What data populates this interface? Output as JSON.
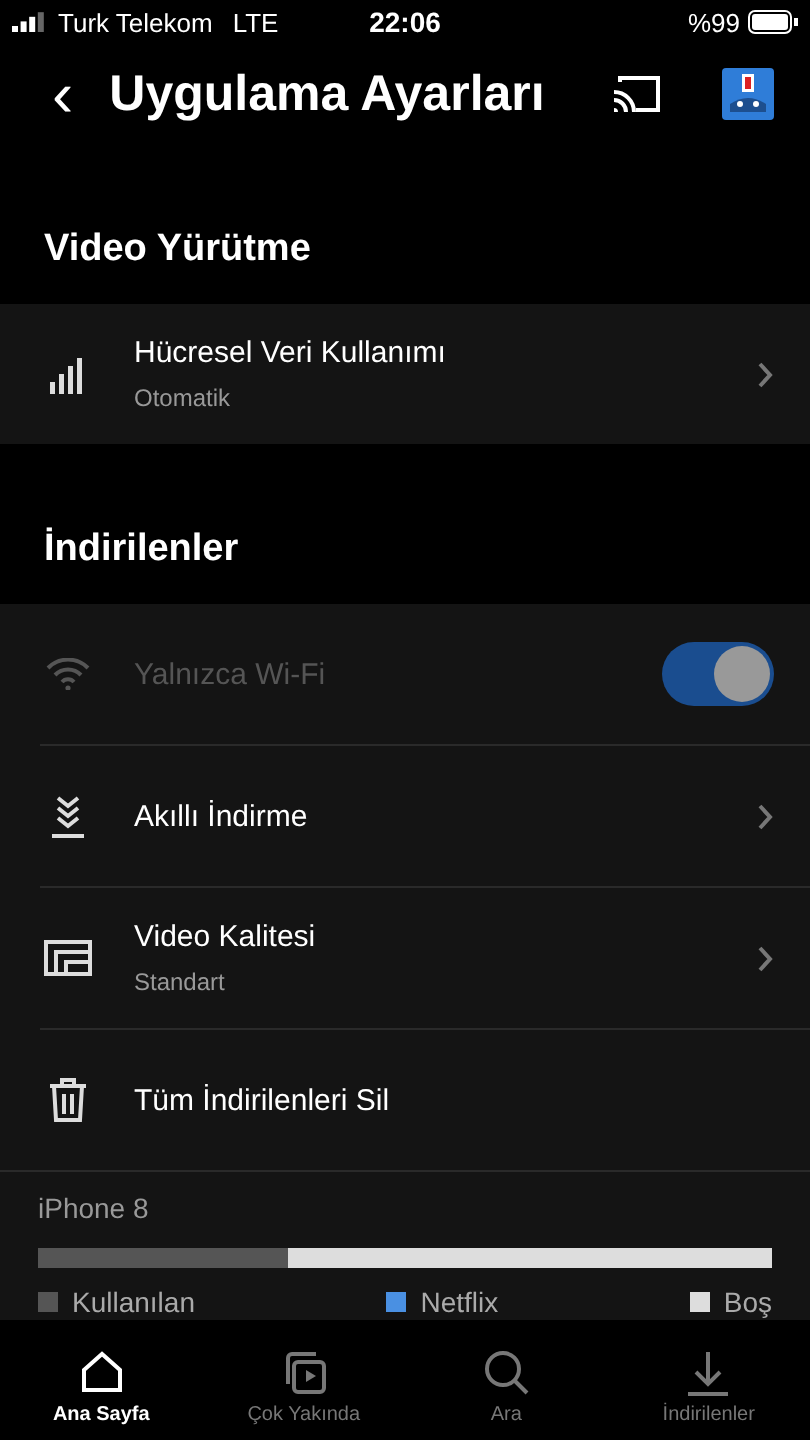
{
  "status_bar": {
    "carrier": "Turk Telekom",
    "network": "LTE",
    "time": "22:06",
    "battery": "%99"
  },
  "header": {
    "back": "‹",
    "title": "Uygulama Ayarları"
  },
  "sections": [
    {
      "title": "Video Yürütme",
      "rows": [
        {
          "kind": "link",
          "label": "Hücresel Veri Kullanımı",
          "sublabel": "Otomatik",
          "disabled": false
        }
      ]
    },
    {
      "title": "İndirilenler",
      "rows": [
        {
          "kind": "toggle",
          "label": "Yalnızca Wi-Fi",
          "disabled": true,
          "on": true
        },
        {
          "kind": "link",
          "label": "Akıllı İndirme",
          "disabled": false
        },
        {
          "kind": "link",
          "label": "Video Kalitesi",
          "sublabel": "Standart",
          "disabled": false
        },
        {
          "kind": "action",
          "label": "Tüm İndirilenleri Sil",
          "disabled": false
        }
      ]
    }
  ],
  "storage": {
    "device": "iPhone 8",
    "segments": [
      {
        "label": "Kullanılan",
        "color": "#555555",
        "level": 0.34
      },
      {
        "label": "Netflix",
        "color": "#4a90e2"
      },
      {
        "label": "Boş",
        "color": "#dddddd",
        "level": 0.66
      }
    ]
  },
  "tab_bar": [
    {
      "label": "Ana Sayfa",
      "selected": true
    },
    {
      "label": "Çok Yakında",
      "selected": false
    },
    {
      "label": "Ara",
      "selected": false
    },
    {
      "label": "İndirilenler",
      "selected": false
    }
  ]
}
